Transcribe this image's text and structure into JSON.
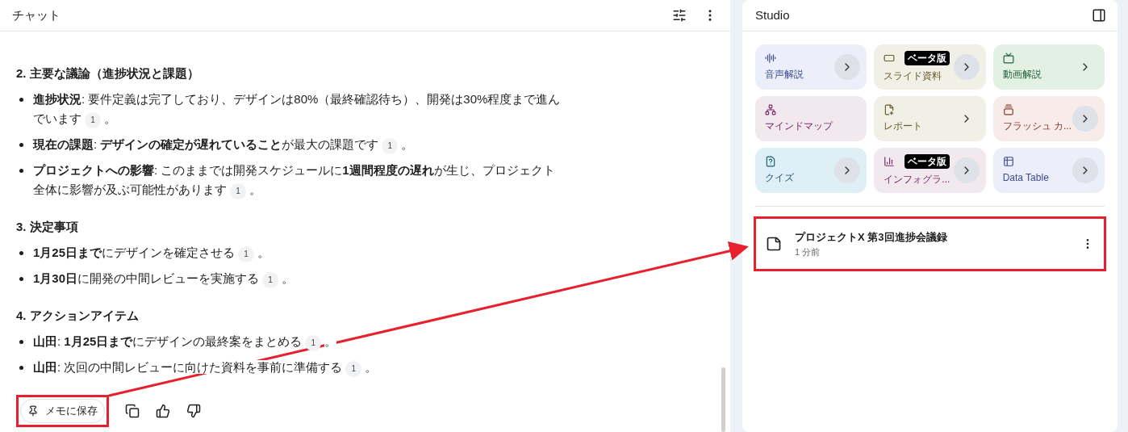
{
  "chat": {
    "title": "チャット",
    "sections": [
      {
        "heading": "2. 主要な議論（進捗状況と課題）",
        "items": [
          {
            "text": "**進捗状況**: 要件定義は完了しており、デザインは80%（最終確認待ち）、開発は30%程度まで進んでいます",
            "citation": "1",
            "end": "。"
          },
          {
            "text": "**現在の課題**: **デザインの確定が遅れていること**が最大の課題です",
            "citation": "1",
            "end": "。"
          },
          {
            "text": "**プロジェクトへの影響**: このままでは開発スケジュールに**1週間程度の遅れ**が生じ、プロジェクト全体に影響が及ぶ可能性があります",
            "citation": "1",
            "end": "。"
          }
        ]
      },
      {
        "heading": "3. 決定事項",
        "items": [
          {
            "text": "**1月25日まで**にデザインを確定させる",
            "citation": "1",
            "end": "。"
          },
          {
            "text": "**1月30日**に開発の中間レビューを実施する",
            "citation": "1",
            "end": "。"
          }
        ]
      },
      {
        "heading": "4. アクションアイテム",
        "items": [
          {
            "text": "**山田**: **1月25日まで**にデザインの最終案をまとめる",
            "citation": "1",
            "end": "。"
          },
          {
            "text": "**山田**: 次回の中間レビューに向けた資料を事前に準備する",
            "citation": "1",
            "end": "。"
          }
        ]
      }
    ],
    "save_button": {
      "label": "メモに保存",
      "highlighted": true
    }
  },
  "studio": {
    "title": "Studio",
    "tiles": [
      {
        "kind": "audio",
        "label": "音声解説"
      },
      {
        "kind": "slides",
        "label": "スライド資料",
        "badge": "ベータ版"
      },
      {
        "kind": "video",
        "label": "動画解説"
      },
      {
        "kind": "mindmap",
        "label": "マインドマップ"
      },
      {
        "kind": "report",
        "label": "レポート"
      },
      {
        "kind": "flashcards",
        "label": "フラッシュ カ..."
      },
      {
        "kind": "quiz",
        "label": "クイズ"
      },
      {
        "kind": "infographic",
        "label": "インフォグラ...",
        "badge": "ベータ版"
      },
      {
        "kind": "table",
        "label": "Data Table"
      }
    ],
    "notes": [
      {
        "title": "プロジェクトX 第3回進捗会議録",
        "time": "1 分前",
        "highlighted": true
      }
    ]
  }
}
